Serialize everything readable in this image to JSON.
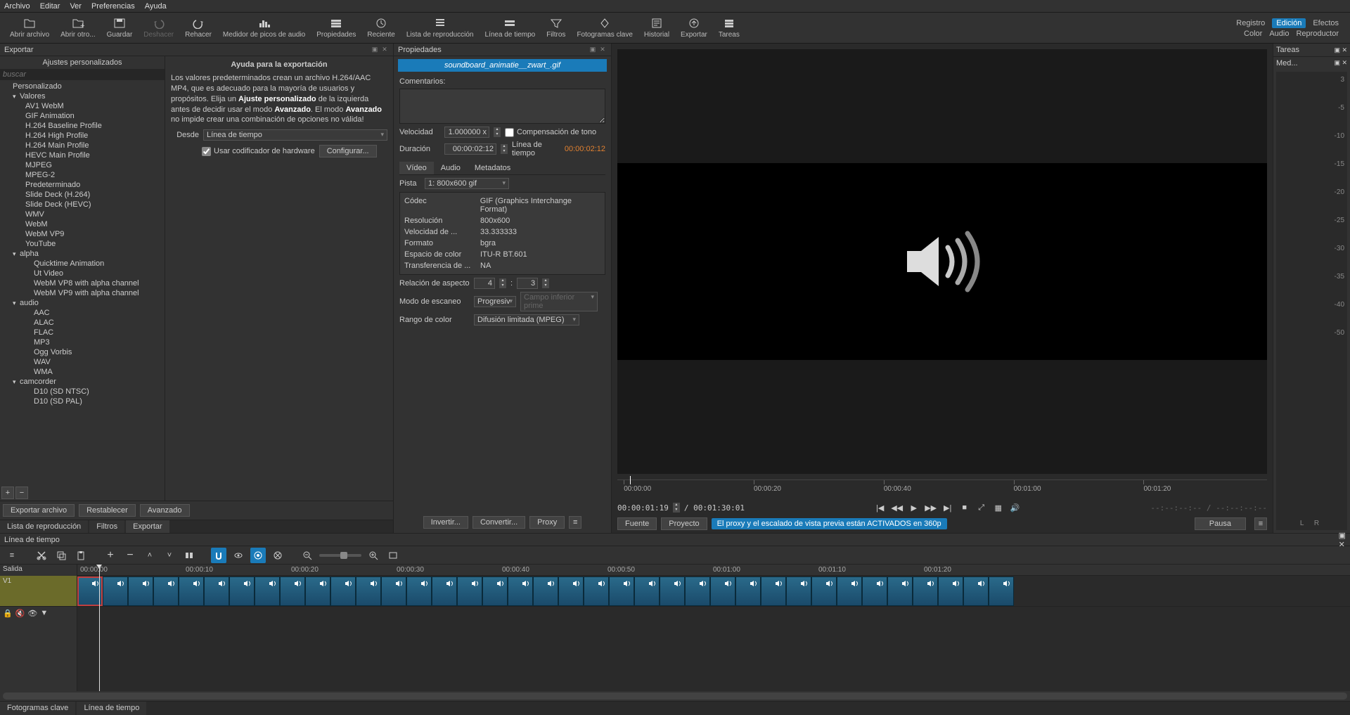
{
  "menu": [
    "Archivo",
    "Editar",
    "Ver",
    "Preferencias",
    "Ayuda"
  ],
  "toolbar": [
    {
      "id": "open",
      "label": "Abrir archivo"
    },
    {
      "id": "open-other",
      "label": "Abrir otro..."
    },
    {
      "id": "save",
      "label": "Guardar"
    },
    {
      "id": "undo",
      "label": "Deshacer",
      "disabled": true
    },
    {
      "id": "redo",
      "label": "Rehacer"
    },
    {
      "id": "peak",
      "label": "Medidor de picos de audio"
    },
    {
      "id": "props",
      "label": "Propiedades"
    },
    {
      "id": "recent",
      "label": "Reciente"
    },
    {
      "id": "playlist",
      "label": "Lista de reproducción"
    },
    {
      "id": "timeline",
      "label": "Línea de tiempo"
    },
    {
      "id": "filters",
      "label": "Filtros"
    },
    {
      "id": "keyframes",
      "label": "Fotogramas clave"
    },
    {
      "id": "history",
      "label": "Historial"
    },
    {
      "id": "export",
      "label": "Exportar"
    },
    {
      "id": "jobs",
      "label": "Tareas"
    }
  ],
  "top_right": {
    "row1": [
      "Registro",
      "Edición",
      "Efectos"
    ],
    "active": "Edición",
    "row2": [
      "Color",
      "Audio",
      "Reproductor"
    ]
  },
  "export": {
    "panel_title": "Exportar",
    "presets_title": "Ajustes personalizados",
    "search_placeholder": "buscar",
    "tree": [
      {
        "t": "item",
        "l": "Personalizado"
      },
      {
        "t": "group",
        "l": "Valores"
      },
      {
        "t": "sub",
        "l": "AV1 WebM"
      },
      {
        "t": "sub",
        "l": "GIF Animation"
      },
      {
        "t": "sub",
        "l": "H.264 Baseline Profile"
      },
      {
        "t": "sub",
        "l": "H.264 High Profile"
      },
      {
        "t": "sub",
        "l": "H.264 Main Profile"
      },
      {
        "t": "sub",
        "l": "HEVC Main Profile"
      },
      {
        "t": "sub",
        "l": "MJPEG"
      },
      {
        "t": "sub",
        "l": "MPEG-2"
      },
      {
        "t": "sub",
        "l": "Predeterminado"
      },
      {
        "t": "sub",
        "l": "Slide Deck (H.264)"
      },
      {
        "t": "sub",
        "l": "Slide Deck (HEVC)"
      },
      {
        "t": "sub",
        "l": "WMV"
      },
      {
        "t": "sub",
        "l": "WebM"
      },
      {
        "t": "sub",
        "l": "WebM VP9"
      },
      {
        "t": "sub",
        "l": "YouTube"
      },
      {
        "t": "group",
        "l": "alpha"
      },
      {
        "t": "sub2",
        "l": "Quicktime Animation"
      },
      {
        "t": "sub2",
        "l": "Ut Video"
      },
      {
        "t": "sub2",
        "l": "WebM VP8 with alpha channel"
      },
      {
        "t": "sub2",
        "l": "WebM VP9 with alpha channel"
      },
      {
        "t": "group",
        "l": "audio"
      },
      {
        "t": "sub2",
        "l": "AAC"
      },
      {
        "t": "sub2",
        "l": "ALAC"
      },
      {
        "t": "sub2",
        "l": "FLAC"
      },
      {
        "t": "sub2",
        "l": "MP3"
      },
      {
        "t": "sub2",
        "l": "Ogg Vorbis"
      },
      {
        "t": "sub2",
        "l": "WAV"
      },
      {
        "t": "sub2",
        "l": "WMA"
      },
      {
        "t": "group",
        "l": "camcorder"
      },
      {
        "t": "sub2",
        "l": "D10 (SD NTSC)"
      },
      {
        "t": "sub2",
        "l": "D10 (SD PAL)"
      }
    ],
    "help_title": "Ayuda para la exportación",
    "help_html": "Los valores predeterminados crean un archivo H.264/AAC MP4, que es adecuado para la mayoría de usuarios y propósitos. Elija un <b>Ajuste personalizado</b> de la izquierda antes de decidir usar el modo <b>Avanzado</b>. El modo <b>Avanzado</b> no impide crear una combinación de opciones no válida!",
    "from_label": "Desde",
    "from_value": "Línea de tiempo",
    "hw_label": "Usar codificador de hardware",
    "config_btn": "Configurar...",
    "foot": [
      "Exportar archivo",
      "Restablecer",
      "Avanzado"
    ],
    "bottom_tabs": [
      "Lista de reproducción",
      "Filtros",
      "Exportar"
    ]
  },
  "props": {
    "panel_title": "Propiedades",
    "clip_name": "soundboard_animatie__zwart_.gif",
    "comments_label": "Comentarios:",
    "speed_label": "Velocidad",
    "speed_value": "1.000000 x",
    "pitch_label": "Compensación de tono",
    "duration_label": "Duración",
    "duration_value": "00:00:02:12",
    "timeline_label": "Línea de tiempo",
    "timeline_value": "00:00:02:12",
    "tabs": [
      "Vídeo",
      "Audio",
      "Metadatos"
    ],
    "track_label": "Pista",
    "track_value": "1: 800x600 gif",
    "kv": [
      {
        "k": "Códec",
        "v": "GIF (Graphics Interchange Format)"
      },
      {
        "k": "Resolución",
        "v": "800x600"
      },
      {
        "k": "Velocidad de ...",
        "v": "33.333333"
      },
      {
        "k": "Formato",
        "v": "bgra"
      },
      {
        "k": "Espacio de color",
        "v": "ITU-R BT.601"
      },
      {
        "k": "Transferencia de ...",
        "v": "NA"
      }
    ],
    "aspect_label": "Relación de aspecto",
    "aspect_w": "4",
    "aspect_h": "3",
    "scan_label": "Modo de escaneo",
    "scan_value": "Progresiv",
    "field_placeholder": "Campo inferior prime",
    "range_label": "Rango de color",
    "range_value": "Difusión limitada (MPEG)",
    "foot": [
      "Invertir...",
      "Convertir...",
      "Proxy"
    ]
  },
  "preview": {
    "ruler": [
      "00:00:00",
      "00:00:20",
      "00:00:40",
      "00:01:00",
      "00:01:20"
    ],
    "playhead_pct": 2,
    "cur_time": "00:00:01:19",
    "total_time": "/ 00:01:30:01",
    "in_out": "--:--:--:-- / --:--:--:--",
    "tabs": [
      "Fuente",
      "Proyecto"
    ],
    "proxy_msg": "El proxy y el escalado de vista previa están ACTIVADOS en 360p",
    "pause": "Pausa"
  },
  "right": {
    "tab1": "Tareas",
    "tab2": "Med...",
    "db": [
      "3",
      "-5",
      "-10",
      "-15",
      "-20",
      "-25",
      "-30",
      "-35",
      "-40",
      "-50"
    ],
    "lr": "L  R"
  },
  "timeline": {
    "title": "Línea de tiempo",
    "output_label": "Salida",
    "track_label": "V1",
    "ruler": [
      "00:00:00",
      "00:00:10",
      "00:00:20",
      "00:00:30",
      "00:00:40",
      "00:00:50",
      "00:01:00",
      "00:01:10",
      "00:01:20"
    ],
    "playhead_pct": 2,
    "clip_count": 37,
    "footer_tabs": [
      "Fotogramas clave",
      "Línea de tiempo"
    ]
  }
}
